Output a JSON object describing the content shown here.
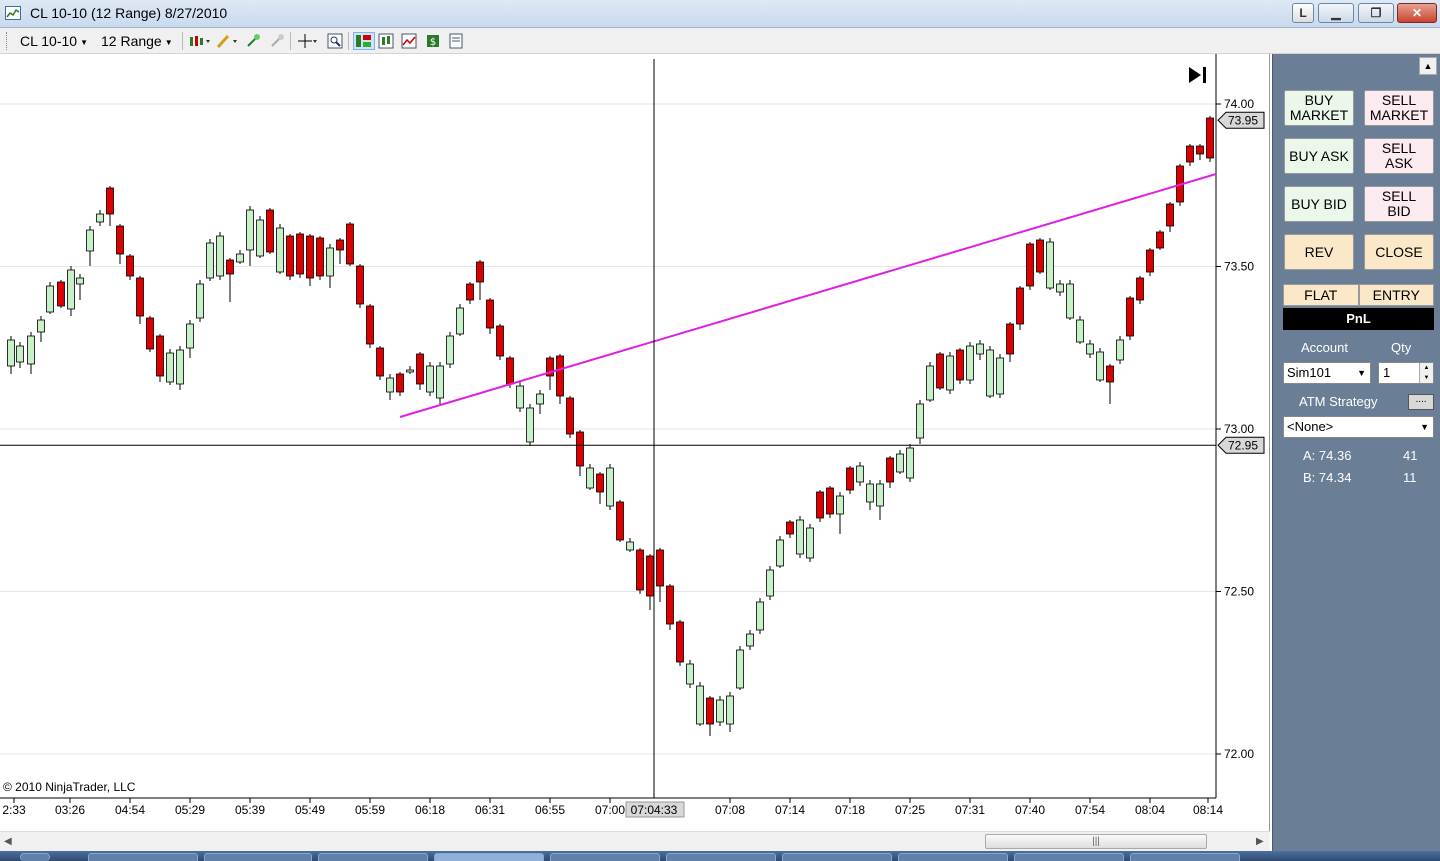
{
  "window": {
    "title": "CL 10-10 (12 Range)  8/27/2010",
    "btn_l": "L",
    "btn_min": "▁",
    "btn_max": "❐",
    "btn_close": "✕"
  },
  "toolbar": {
    "instrument": "CL 10-10",
    "period": "12 Range",
    "icons": [
      "bar-type-icon",
      "drawing-pencil-icon",
      "zoom-in-icon",
      "zoom-out-icon",
      "crosshair-icon",
      "data-box-icon",
      "chart-trader-icon",
      "strategies-icon",
      "indicators-icon",
      "dollar-icon",
      "properties-icon"
    ]
  },
  "chart": {
    "copyright": "© 2010 NinjaTrader, LLC",
    "price_labels": [
      "74.00",
      "73.50",
      "73.00",
      "72.50",
      "72.00"
    ],
    "last_price_marker": "73.95",
    "crosshair_price_marker": "72.95",
    "time_labels": [
      "2:33",
      "03:26",
      "04:54",
      "05:29",
      "05:39",
      "05:49",
      "05:59",
      "06:18",
      "06:31",
      "06:55",
      "07:00",
      "07:08",
      "07:14",
      "07:18",
      "07:25",
      "07:31",
      "07:40",
      "07:54",
      "08:04",
      "08:14"
    ],
    "crosshair_time": "07:04:33",
    "up_color": "#c8f0c8",
    "down_color": "#dd0000",
    "trendline_color": "#e020e0"
  },
  "panel": {
    "buy_market": "BUY\nMARKET",
    "sell_market": "SELL\nMARKET",
    "buy_ask": "BUY ASK",
    "sell_ask": "SELL\nASK",
    "buy_bid": "BUY BID",
    "sell_bid": "SELL\nBID",
    "rev": "REV",
    "close": "CLOSE",
    "flat": "FLAT",
    "entry": "ENTRY",
    "pnl": "PnL",
    "account_label": "Account",
    "qty_label": "Qty",
    "account_value": "Sim101",
    "qty_value": "1",
    "atm_label": "ATM Strategy",
    "atm_button": "....",
    "atm_value": "<None>",
    "ask_label": "A: 74.36",
    "ask_size": "41",
    "bid_label": "B: 74.34",
    "bid_size": "11"
  }
}
